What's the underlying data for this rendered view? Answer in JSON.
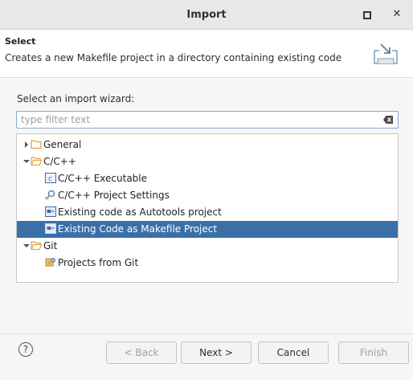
{
  "window": {
    "title": "Import"
  },
  "header": {
    "title": "Select",
    "description": "Creates a new Makefile project in a directory containing existing code"
  },
  "wizard": {
    "label": "Select an import wizard:",
    "filter_placeholder": "type filter text"
  },
  "tree": {
    "items": [
      {
        "label": "General",
        "icon": "folder-icon",
        "expanded": false,
        "depth": 0
      },
      {
        "label": "C/C++",
        "icon": "folder-icon",
        "expanded": true,
        "depth": 0
      },
      {
        "label": "C/C++ Executable",
        "icon": "c-executable-icon",
        "depth": 1
      },
      {
        "label": "C/C++ Project Settings",
        "icon": "project-settings-icon",
        "depth": 1
      },
      {
        "label": "Existing code as Autotools project",
        "icon": "autotools-icon",
        "depth": 1
      },
      {
        "label": "Existing Code as Makefile Project",
        "icon": "makefile-icon",
        "depth": 1,
        "selected": true
      },
      {
        "label": "Git",
        "icon": "folder-icon",
        "expanded": true,
        "depth": 0
      },
      {
        "label": "Projects from Git",
        "icon": "git-icon",
        "depth": 1
      }
    ]
  },
  "footer": {
    "help_label": "?",
    "back_label": "< Back",
    "next_label": "Next >",
    "cancel_label": "Cancel",
    "finish_label": "Finish"
  },
  "colors": {
    "selection": "#3b6fa8",
    "folder": "#e8a33d",
    "filter_border": "#8aa8c6"
  }
}
